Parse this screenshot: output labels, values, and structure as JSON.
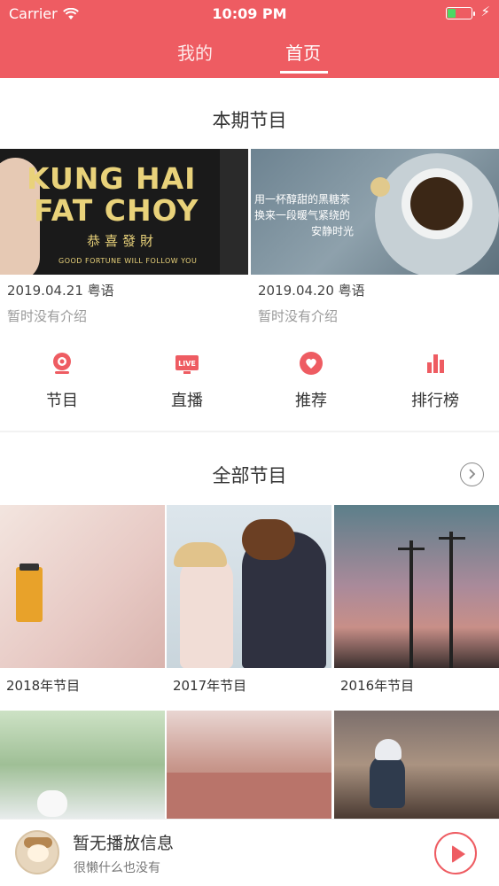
{
  "status_bar": {
    "carrier": "Carrier",
    "time": "10:09 PM",
    "battery_level": 0.35,
    "battery_color": "#4cd964"
  },
  "header": {
    "bg_color": "#ee5c62",
    "tabs": [
      {
        "label": "我的",
        "active": false
      },
      {
        "label": "首页",
        "active": true
      }
    ]
  },
  "current_section": {
    "title": "本期节目",
    "episodes": [
      {
        "image_text": {
          "line1": "KUNG HAI",
          "line2": "FAT CHOY",
          "cn": "恭喜發財",
          "en": "GOOD FORTUNE WILL FOLLOW YOU"
        },
        "meta": "2019.04.21 粤语",
        "desc": "暂时没有介绍"
      },
      {
        "image_text": {
          "line1": "用一杯醇甜的黑糖茶",
          "line2": "换来一段暖气紧绕的",
          "line3": "安静时光"
        },
        "meta": "2019.04.20 粤语",
        "desc": "暂时没有介绍"
      }
    ]
  },
  "categories": [
    {
      "label": "节目",
      "icon": "webcam-icon"
    },
    {
      "label": "直播",
      "icon": "live-tv-icon",
      "badge": "LIVE"
    },
    {
      "label": "推荐",
      "icon": "heart-icon"
    },
    {
      "label": "排行榜",
      "icon": "bar-chart-icon"
    }
  ],
  "all_section": {
    "title": "全部节目",
    "more_icon": "chevron-right-circle-icon",
    "items": [
      {
        "label": "2018年节目"
      },
      {
        "label": "2017年节目"
      },
      {
        "label": "2016年节目"
      },
      {
        "label": ""
      },
      {
        "label": ""
      },
      {
        "label": ""
      }
    ]
  },
  "player": {
    "title": "暂无播放信息",
    "subtitle": "很懒什么也没有",
    "play_icon": "play-icon",
    "accent_color": "#ee5c62"
  }
}
